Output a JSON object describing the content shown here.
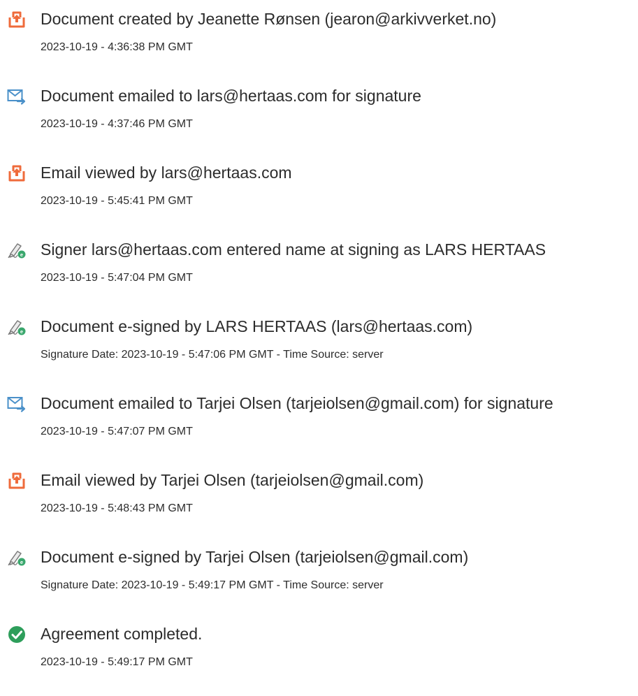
{
  "colors": {
    "document_icon": "#ef6b3b",
    "email_icon": "#4a90c9",
    "signature_icon": "#e0e0e0",
    "signature_badge": "#3aa76d",
    "completed_icon": "#2e9e5b",
    "text": "#2c2c2c"
  },
  "events": [
    {
      "icon": "document-icon",
      "title": "Document created by Jeanette Rønsen (jearon@arkivverket.no)",
      "detail": "2023-10-19 - 4:36:38 PM GMT"
    },
    {
      "icon": "email-icon",
      "title": "Document emailed to lars@hertaas.com for signature",
      "detail": "2023-10-19 - 4:37:46 PM GMT"
    },
    {
      "icon": "document-icon",
      "title": "Email viewed by lars@hertaas.com",
      "detail": "2023-10-19 - 5:45:41 PM GMT"
    },
    {
      "icon": "signature-icon",
      "title": "Signer lars@hertaas.com entered name at signing as LARS HERTAAS",
      "detail": "2023-10-19 - 5:47:04 PM GMT"
    },
    {
      "icon": "signature-icon",
      "title": "Document e-signed by LARS HERTAAS (lars@hertaas.com)",
      "detail": "Signature Date: 2023-10-19 - 5:47:06 PM GMT - Time Source: server"
    },
    {
      "icon": "email-icon",
      "title": "Document emailed to Tarjei Olsen (tarjeiolsen@gmail.com) for signature",
      "detail": "2023-10-19 - 5:47:07 PM GMT"
    },
    {
      "icon": "document-icon",
      "title": "Email viewed by Tarjei Olsen (tarjeiolsen@gmail.com)",
      "detail": "2023-10-19 - 5:48:43 PM GMT"
    },
    {
      "icon": "signature-icon",
      "title": "Document e-signed by Tarjei Olsen (tarjeiolsen@gmail.com)",
      "detail": "Signature Date: 2023-10-19 - 5:49:17 PM GMT - Time Source: server"
    },
    {
      "icon": "checkmark-icon",
      "title": "Agreement completed.",
      "detail": "2023-10-19 - 5:49:17 PM GMT"
    }
  ]
}
